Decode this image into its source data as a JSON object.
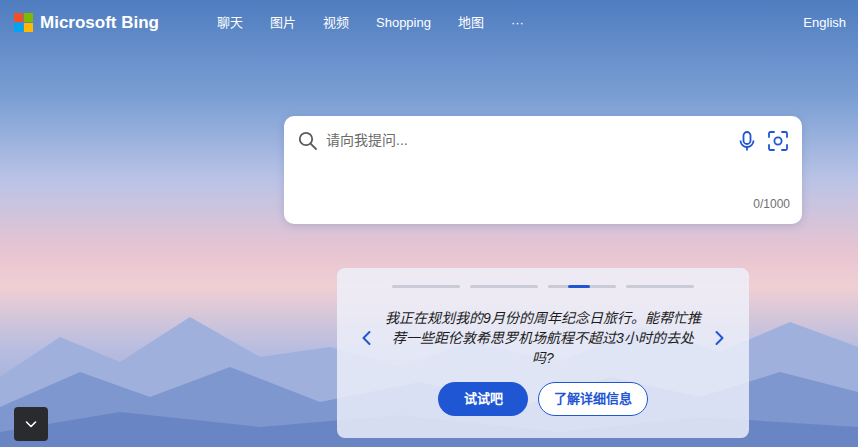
{
  "logo": {
    "text": "Microsoft Bing"
  },
  "nav": {
    "items": [
      "聊天",
      "图片",
      "视频",
      "Shopping",
      "地图",
      "···"
    ],
    "language": "English"
  },
  "search": {
    "placeholder": "请向我提问...",
    "counter": "0/1000"
  },
  "carousel": {
    "pages": [
      {
        "selected": false
      },
      {
        "selected": false
      },
      {
        "selected": true
      },
      {
        "selected": false
      }
    ],
    "prompt": "我正在规划我的9月份的周年纪念日旅行。能帮忙推荐一些距伦敦希思罗机场航程不超过3小时的去处吗?",
    "buttons": [
      "试试吧",
      "了解详细信息"
    ]
  }
}
